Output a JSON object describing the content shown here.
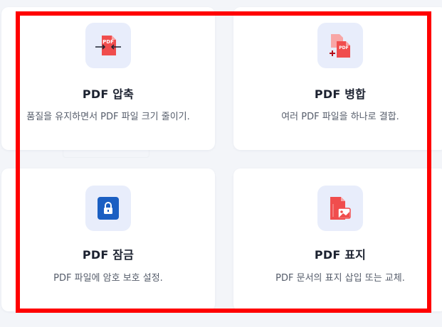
{
  "cards": [
    {
      "title": "PDF 압축",
      "desc": "품질을 유지하면서 PDF 파일 크기 줄이기.",
      "icon": "compress-pdf-icon",
      "icon_text": "PDF"
    },
    {
      "title": "PDF 병합",
      "desc": "여러 PDF 파일을 하나로 결합.",
      "icon": "merge-pdf-icon",
      "icon_text": "PDF"
    },
    {
      "title": "PDF 잠금",
      "desc": "PDF 파일에 암호 보호 설정.",
      "icon": "lock-pdf-icon"
    },
    {
      "title": "PDF 표지",
      "desc": "PDF 문서의 표지 삽입 또는 교체.",
      "icon": "cover-pdf-icon"
    }
  ],
  "colors": {
    "accent_red": "#f04d4d",
    "lock_blue": "#1b5fc2",
    "tile_bg": "#e8edfb",
    "highlight": "#ff0000"
  }
}
